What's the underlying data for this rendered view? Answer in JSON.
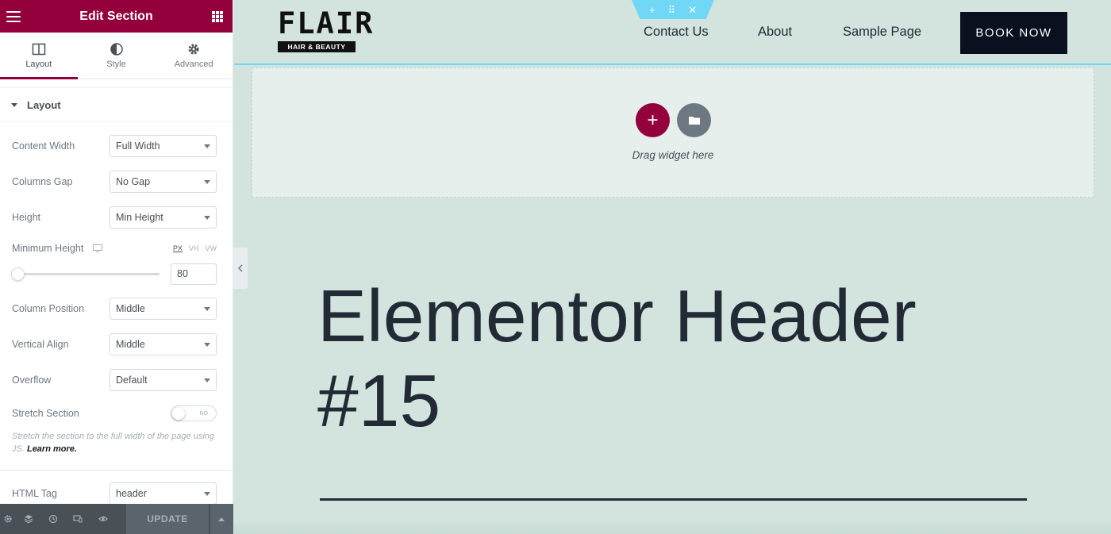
{
  "panel": {
    "title": "Edit Section",
    "tabs": [
      {
        "label": "Layout",
        "icon": "layout-columns-icon",
        "active": true
      },
      {
        "label": "Style",
        "icon": "half-circle-icon",
        "active": false
      },
      {
        "label": "Advanced",
        "icon": "gear-icon",
        "active": false
      }
    ],
    "section_label": "Layout",
    "controls": {
      "content_width": {
        "label": "Content Width",
        "value": "Full Width"
      },
      "columns_gap": {
        "label": "Columns Gap",
        "value": "No Gap"
      },
      "height": {
        "label": "Height",
        "value": "Min Height"
      },
      "minimum_height": {
        "label": "Minimum Height",
        "units": [
          "PX",
          "VH",
          "VW"
        ],
        "active_unit": "PX",
        "value": "80"
      },
      "column_position": {
        "label": "Column Position",
        "value": "Middle"
      },
      "vertical_align": {
        "label": "Vertical Align",
        "value": "Middle"
      },
      "overflow": {
        "label": "Overflow",
        "value": "Default"
      },
      "stretch_section": {
        "label": "Stretch Section",
        "toggle_text": "NO",
        "enabled": false
      },
      "html_tag": {
        "label": "HTML Tag",
        "value": "header"
      }
    },
    "help_text": "Stretch the section to the full width of the page using JS.",
    "help_link": "Learn more.",
    "footer": {
      "update_label": "UPDATE"
    }
  },
  "site": {
    "logo_main": "FLAIR",
    "logo_sub": "HAIR & BEAUTY",
    "nav": [
      "Contact Us",
      "About",
      "Sample Page"
    ],
    "cta": "BOOK NOW",
    "dropzone_text": "Drag widget here",
    "hero_line1": "Elementor Header",
    "hero_line2": "#15"
  },
  "colors": {
    "brand": "#93003c",
    "canvas_bg": "#d3e3dd",
    "section_outline": "#71d7f7",
    "footer_bg": "#495157"
  }
}
